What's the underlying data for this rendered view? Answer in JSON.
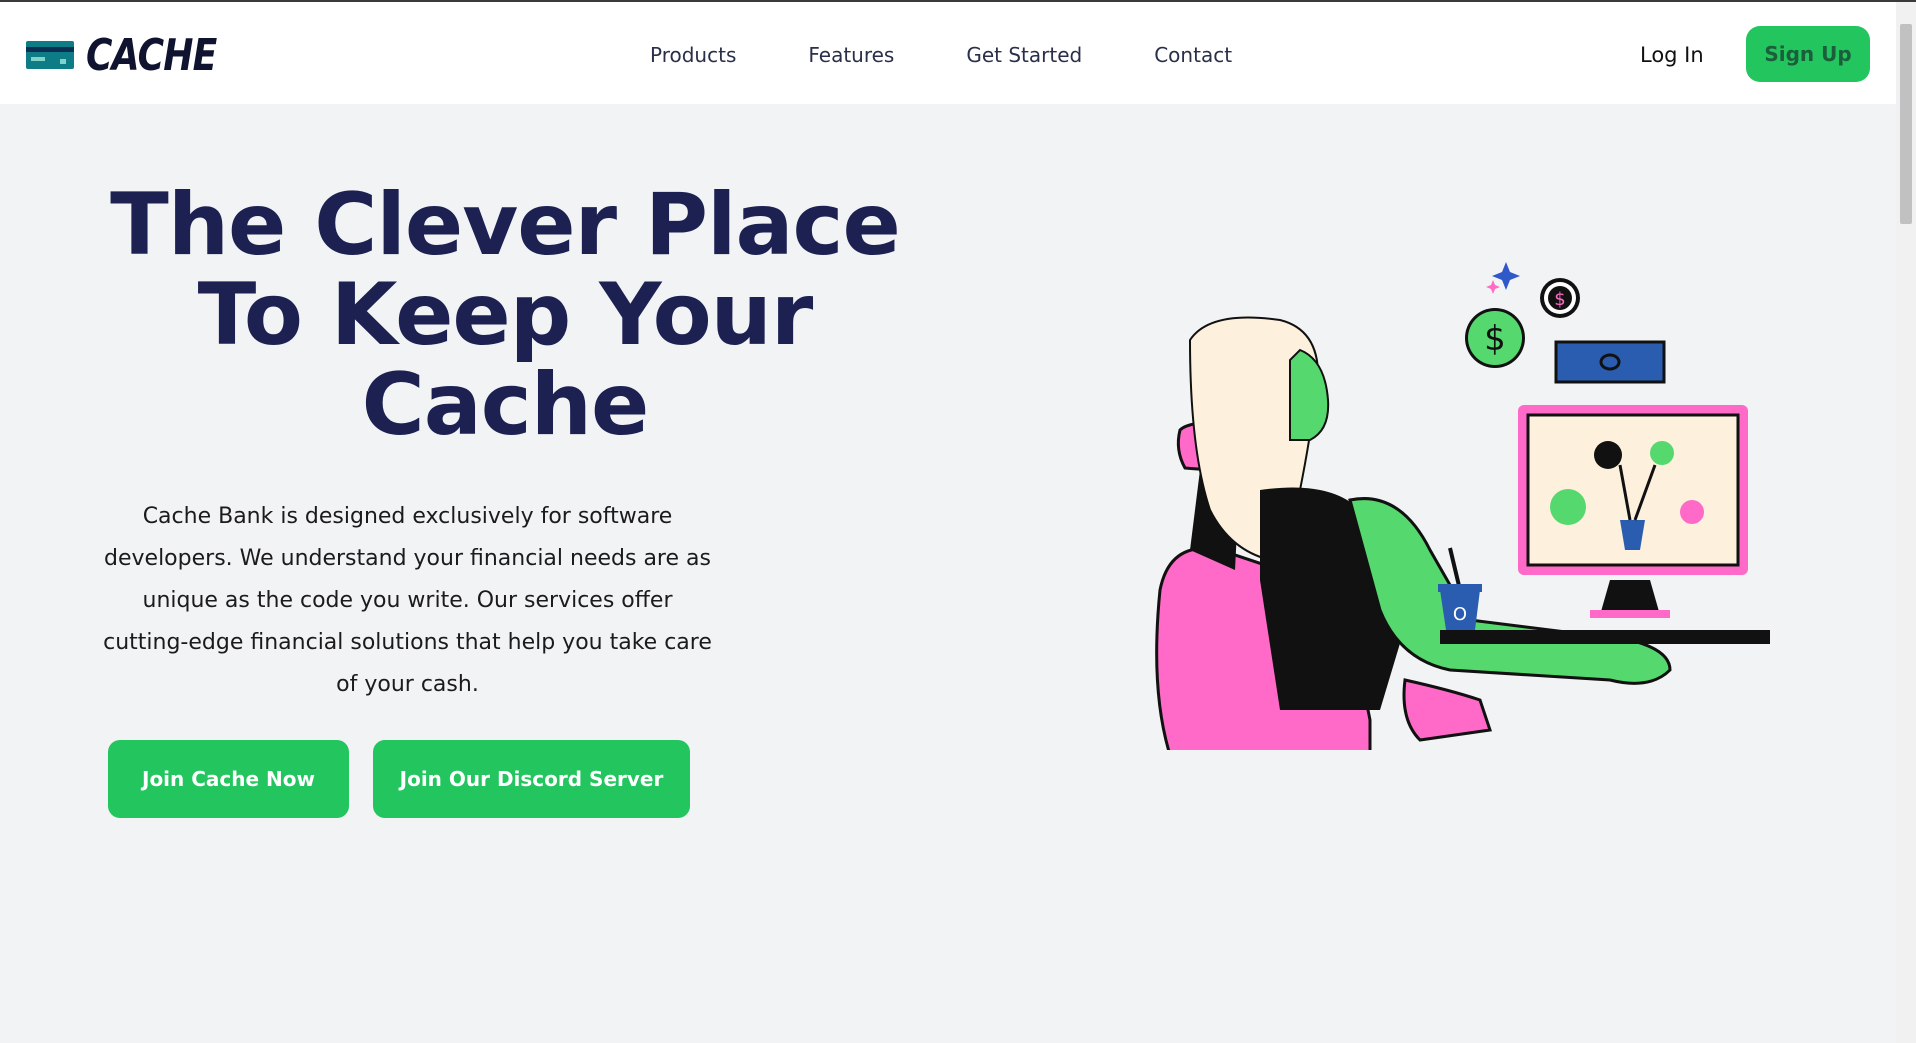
{
  "header": {
    "brand": "CACHE",
    "nav": [
      "Products",
      "Features",
      "Get Started",
      "Contact"
    ],
    "login": "Log In",
    "signup": "Sign Up"
  },
  "hero": {
    "title_line1": "The Clever Place",
    "title_line2": "To Keep Your",
    "title_line3": "Cache",
    "description": "Cache Bank is designed exclusively for software developers. We understand your financial needs are as unique as the code you write. Our services offer cutting-edge financial solutions that help you take care of your cash.",
    "cta_primary": "Join Cache Now",
    "cta_secondary": "Join Our Discord Server"
  },
  "colors": {
    "accent": "#22c55e",
    "heading": "#1c2152",
    "background": "#f2f3f5"
  }
}
